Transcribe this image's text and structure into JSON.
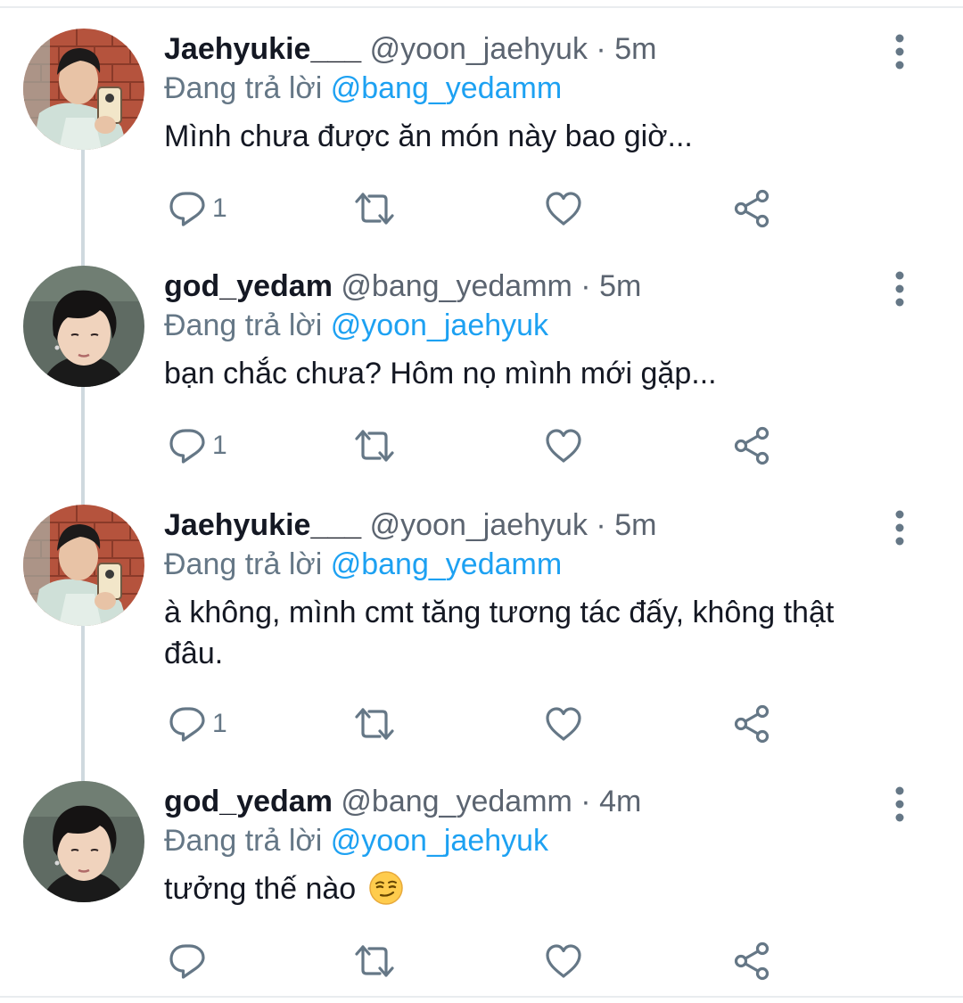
{
  "tweets": [
    {
      "name": "Jaehyukie___",
      "handle": "@yoon_jaehyuk",
      "dot": "·",
      "time": "5m",
      "replying_prefix": "Đang trả lời",
      "replying_to": "@bang_yedamm",
      "text": "Mình chưa được ăn món này bao giờ...",
      "reply_count": "1",
      "avatar": "jaehyuk-avatar"
    },
    {
      "name": "god_yedam",
      "handle": "@bang_yedamm",
      "dot": "·",
      "time": "5m",
      "replying_prefix": "Đang trả lời",
      "replying_to": "@yoon_jaehyuk",
      "text": "bạn chắc chưa? Hôm nọ mình mới gặp...",
      "reply_count": "1",
      "avatar": "yedam-avatar"
    },
    {
      "name": "Jaehyukie___",
      "handle": "@yoon_jaehyuk",
      "dot": "·",
      "time": "5m",
      "replying_prefix": "Đang trả lời",
      "replying_to": "@bang_yedamm",
      "text": "à không, mình cmt tăng tương tác đấy, không thật đâu.",
      "reply_count": "1",
      "avatar": "jaehyuk-avatar"
    },
    {
      "name": "god_yedam",
      "handle": "@bang_yedamm",
      "dot": "·",
      "time": "4m",
      "replying_prefix": "Đang trả lời",
      "replying_to": "@yoon_jaehyuk",
      "text": "tưởng thế nào",
      "emoji": "smirking-face-emoji",
      "reply_count": "",
      "avatar": "yedam-avatar"
    }
  ],
  "icons": {
    "reply": "reply-icon",
    "retweet": "retweet-icon",
    "like": "heart-icon",
    "share": "share-icon",
    "more": "more-vertical-icon"
  },
  "colors": {
    "link": "#1da1f2",
    "secondary": "#657786",
    "thread_line": "#cfd9de",
    "text": "#141823"
  }
}
